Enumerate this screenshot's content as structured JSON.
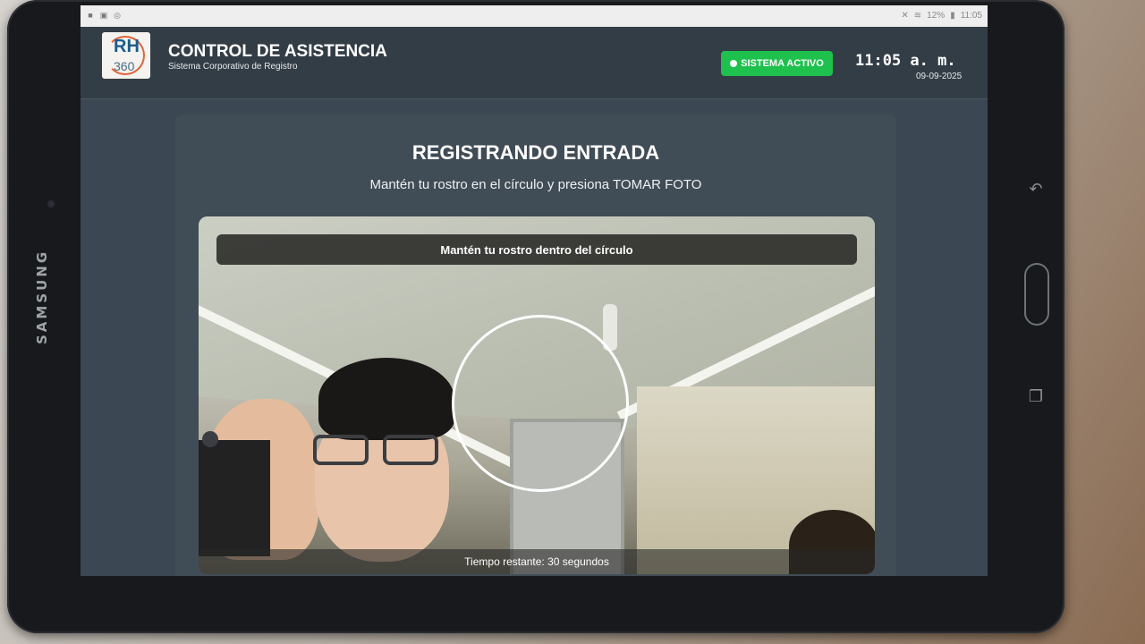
{
  "device": {
    "brand": "SAMSUNG"
  },
  "statusbar": {
    "battery": "12%",
    "time": "11:05"
  },
  "header": {
    "logo_text": "RH",
    "logo_number": "360",
    "title": "CONTROL DE ASISTENCIA",
    "subtitle": "Sistema Corporativo de Registro",
    "status_label": "SISTEMA ACTIVO",
    "clock": "11:05 a. m.",
    "date": "09-09-2025"
  },
  "main": {
    "title": "REGISTRANDO ENTRADA",
    "subtitle": "Mantén tu rostro en el círculo y presiona TOMAR FOTO",
    "camera_banner": "Mantén tu rostro dentro del círculo",
    "timer": "Tiempo restante: 30 segundos"
  },
  "colors": {
    "status_green": "#1fc14e",
    "header_bg": "#333d45",
    "card_bg": "#404c56"
  },
  "icons": {
    "statusbar_left": [
      "video-icon",
      "image-icon",
      "sync-icon"
    ],
    "statusbar_right": [
      "mute-icon",
      "wifi-icon",
      "battery-icon"
    ]
  }
}
